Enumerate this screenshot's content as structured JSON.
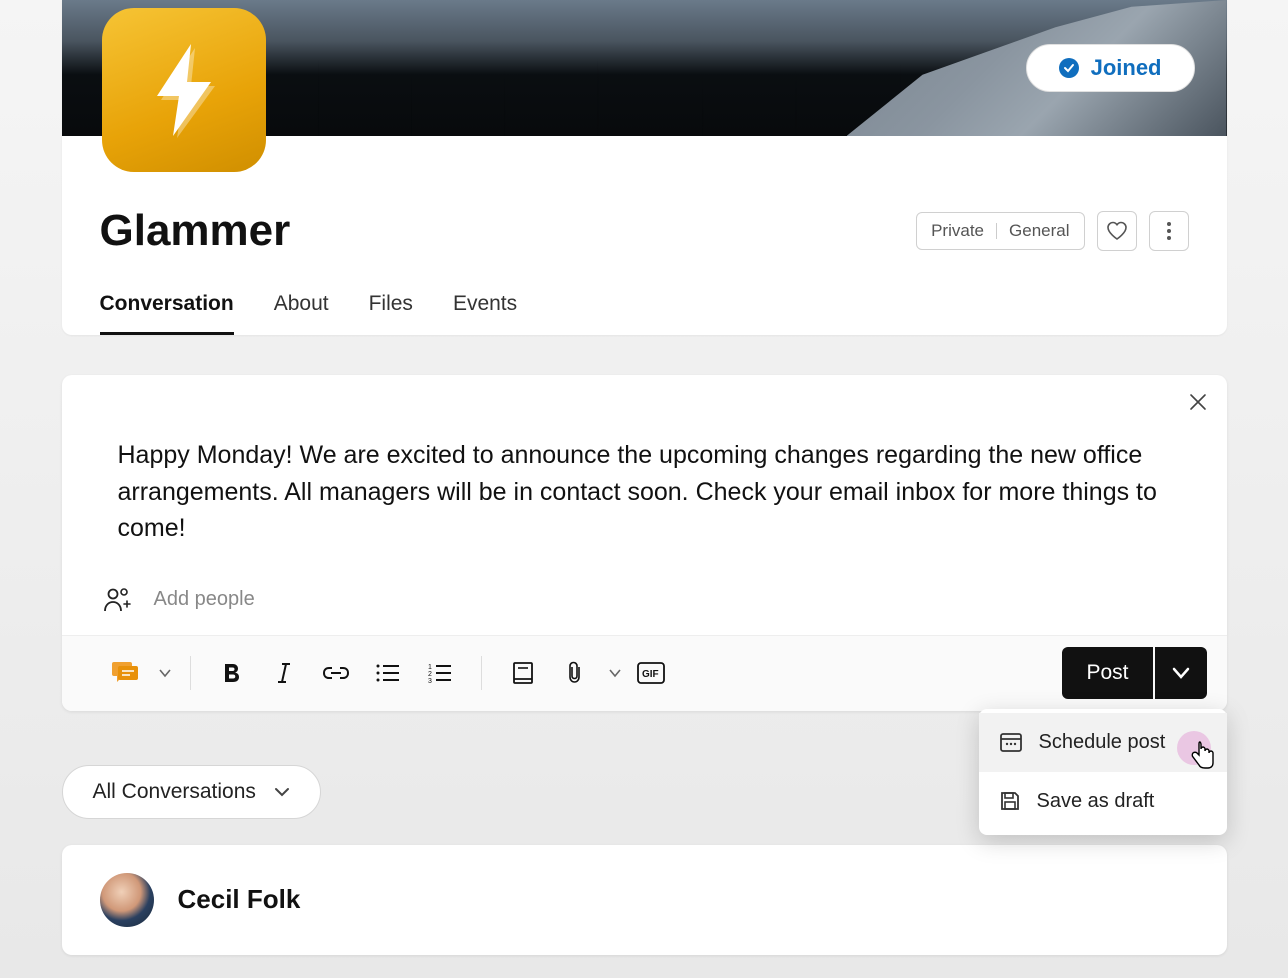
{
  "header": {
    "group_name": "Glammer",
    "joined_label": "Joined",
    "badge": {
      "left": "Private",
      "right": "General"
    }
  },
  "tabs": [
    {
      "label": "Conversation",
      "active": true
    },
    {
      "label": "About",
      "active": false
    },
    {
      "label": "Files",
      "active": false
    },
    {
      "label": "Events",
      "active": false
    }
  ],
  "composer": {
    "text": "Happy Monday! We are excited to announce the upcoming changes regarding the new office arrangements. All managers will be in contact soon. Check your email inbox for more things to come!",
    "add_people_placeholder": "Add people",
    "post_button": "Post",
    "menu": {
      "schedule": "Schedule post",
      "draft": "Save as draft"
    }
  },
  "filter": {
    "label": "All Conversations"
  },
  "feed": {
    "item0": {
      "author": "Cecil Folk"
    }
  },
  "icons": {
    "bolt": "bolt-icon",
    "heart": "heart-icon",
    "more": "more-vertical-icon",
    "close": "close-icon",
    "people": "people-add-icon",
    "discussion": "discussion-icon",
    "bold": "bold-icon",
    "italic": "italic-icon",
    "link": "link-icon",
    "bullet": "bullet-list-icon",
    "number": "number-list-icon",
    "book": "book-icon",
    "attach": "attach-icon",
    "gif": "gif-icon",
    "chevron_down": "chevron-down-icon",
    "calendar": "calendar-icon",
    "save": "save-icon",
    "check": "check-icon"
  }
}
